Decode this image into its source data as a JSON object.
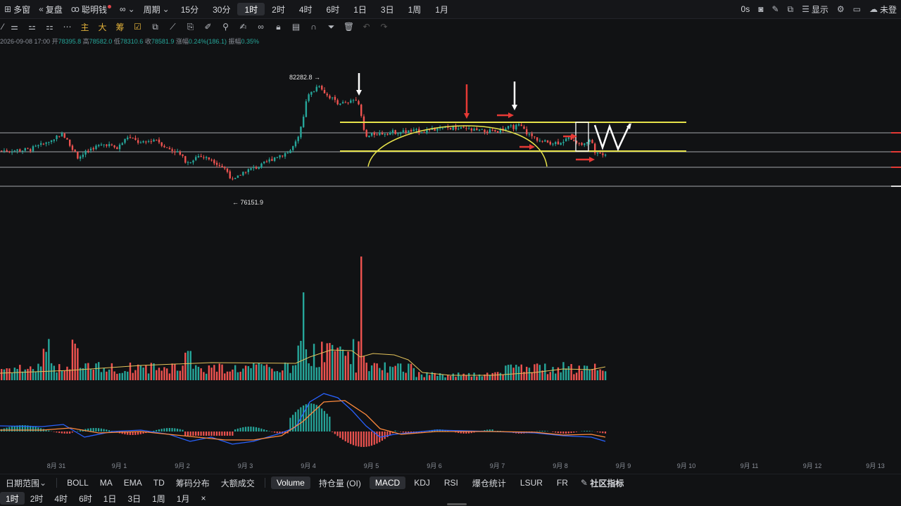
{
  "topbar": {
    "multi_window": "多窗",
    "replay": "复盘",
    "smart_money": "聪明钱",
    "compare_icon": "∞",
    "period": "周期",
    "timeframes": [
      "15分",
      "30分",
      "1时",
      "2时",
      "4时",
      "6时",
      "1日",
      "3日",
      "1周",
      "1月"
    ],
    "active_timeframe": "1时",
    "latency": "0s",
    "display": "显示",
    "account_partial": "未登"
  },
  "toolbar2": {
    "main_label": "主",
    "big_label": "大",
    "chips_label": "筹"
  },
  "info": {
    "datetime": "2026-09-08 17:00",
    "open_label": "开",
    "open": "78395.8",
    "high_label": "高",
    "high": "78582.0",
    "low_label": "低",
    "low": "78310.6",
    "close_label": "收",
    "close": "78581.9",
    "change_label": "涨幅",
    "change": "0.24%(186.1)",
    "amplitude_label": "振幅",
    "amplitude": "0.35%"
  },
  "chart_data": {
    "type": "candlestick",
    "high_label": "82282.8",
    "low_label": "76151.9",
    "x_ticks": [
      "8月 31",
      "9月 1",
      "9月 2",
      "9月 3",
      "9月 4",
      "9月 5",
      "9月 6",
      "9月 7",
      "9月 8",
      "9月 9",
      "9月 10",
      "9月 11",
      "9月 12",
      "9月 13"
    ],
    "price_range": [
      75000,
      84000
    ],
    "colors": {
      "up": "#26a69a",
      "down": "#ef5350",
      "annotation_yellow": "#e6e24a",
      "annotation_red": "#e53935",
      "annotation_white": "#ffffff",
      "ma": "#e3c25a",
      "macd_dif": "#2962ff",
      "macd_dea": "#ff8a3d"
    },
    "horizontal_levels": [
      79400,
      78950,
      78550,
      78050
    ]
  },
  "indicators": {
    "date_range": "日期范围",
    "items": [
      "BOLL",
      "MA",
      "EMA",
      "TD",
      "筹码分布",
      "大额成交"
    ],
    "sub_items": [
      "Volume",
      "持仓量 (OI)",
      "MACD",
      "KDJ",
      "RSI",
      "爆仓统计",
      "LSUR",
      "FR"
    ],
    "active": [
      "Volume",
      "MACD"
    ],
    "community": "社区指标"
  },
  "bottom_tf": {
    "items": [
      "1时",
      "2时",
      "4时",
      "6时",
      "1日",
      "3日",
      "1周",
      "1月"
    ],
    "active": "1时",
    "close": "×"
  }
}
